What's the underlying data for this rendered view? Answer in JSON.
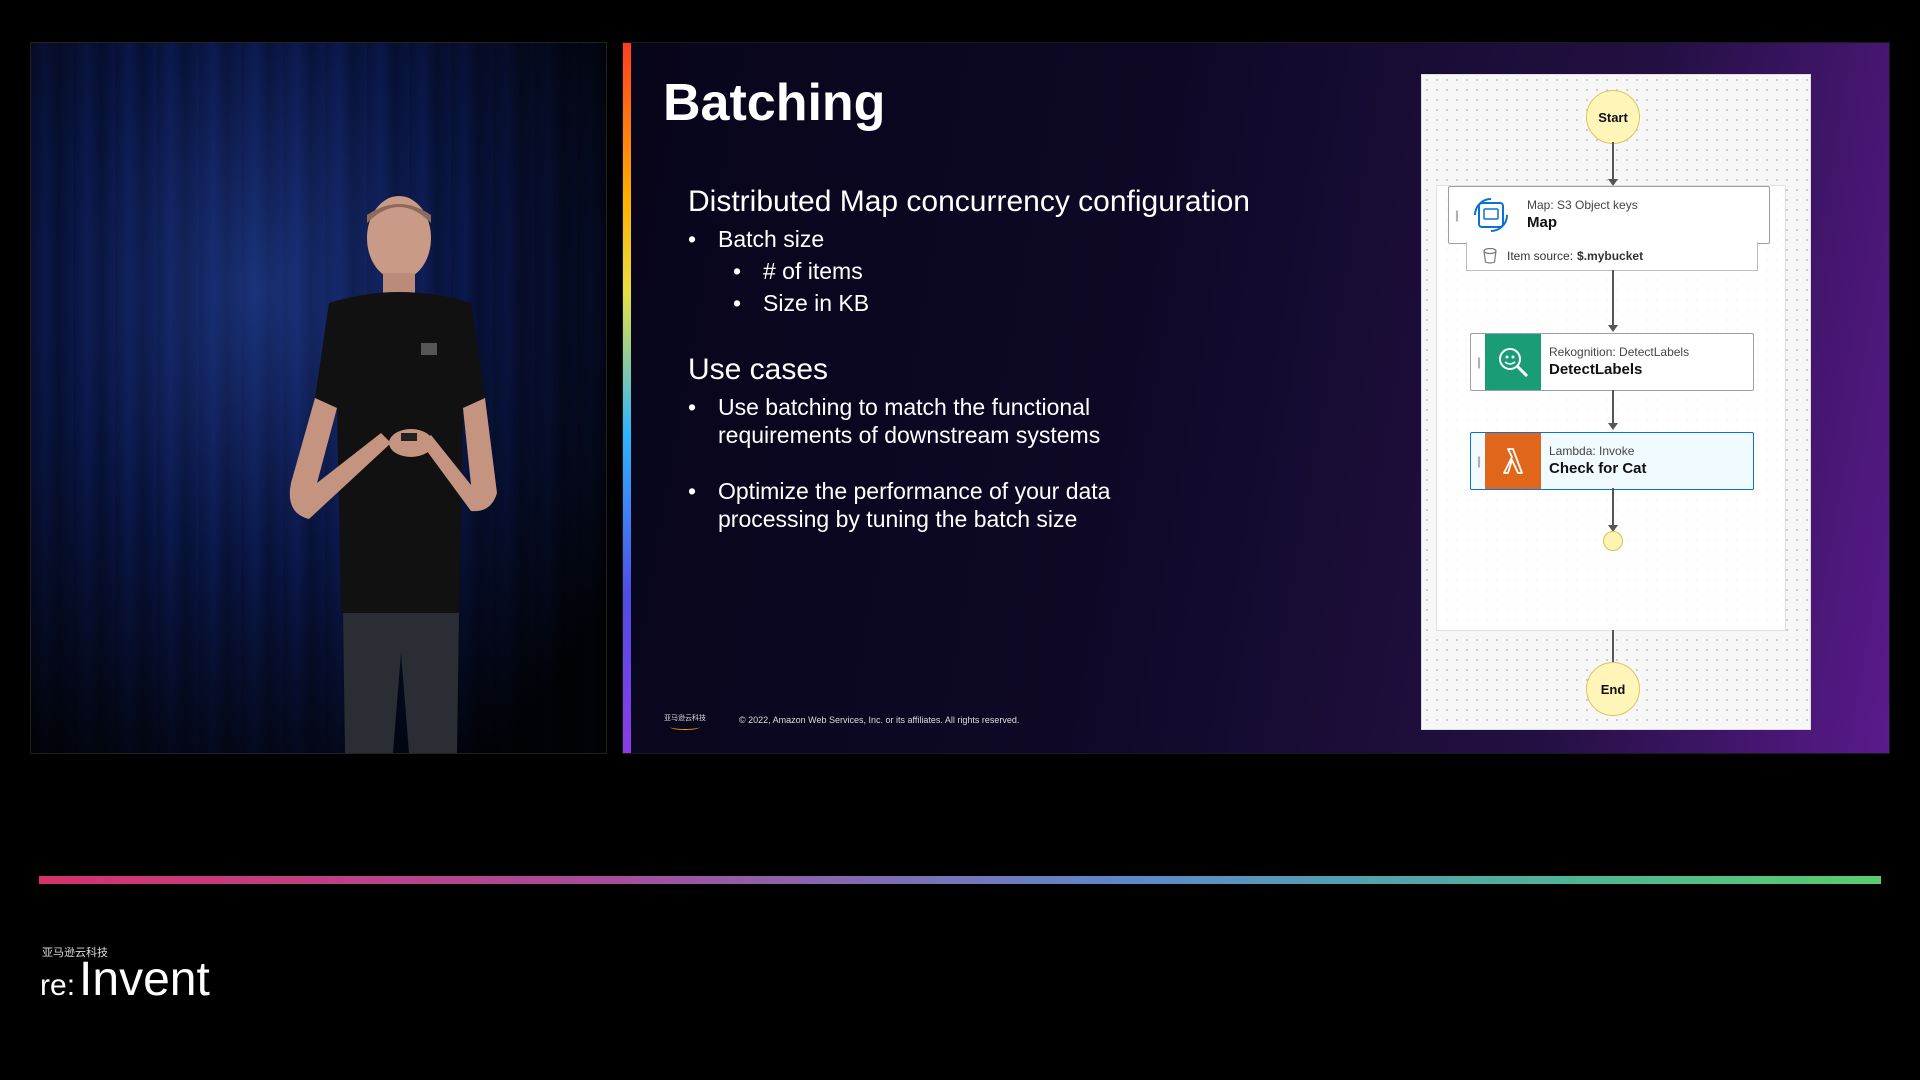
{
  "slide": {
    "title": "Batching",
    "section1": {
      "heading": "Distributed Map concurrency configuration",
      "bullet": "Batch size",
      "sub_bullets": [
        "# of items",
        "Size in KB"
      ]
    },
    "section2": {
      "heading": "Use cases",
      "bullets": [
        "Use batching to match the functional requirements of downstream systems",
        "Optimize the performance of your data processing by tuning the batch size"
      ]
    },
    "footer": {
      "logo_text": "亚马逊云科技",
      "copyright": "© 2022, Amazon Web Services, Inc. or its affiliates. All rights reserved."
    }
  },
  "workflow": {
    "start_label": "Start",
    "end_label": "End",
    "map_state": {
      "type": "Map: S3 Object keys",
      "name": "Map"
    },
    "item_source": {
      "label": "Item source:",
      "value": "$.mybucket"
    },
    "rekognition_state": {
      "type": "Rekognition: DetectLabels",
      "name": "DetectLabels"
    },
    "lambda_state": {
      "type": "Lambda: Invoke",
      "name": "Check for Cat"
    },
    "colors": {
      "terminal_fill": "#fff5b8",
      "map_icon": "#0972d3",
      "rekognition_icon": "#1a9c77",
      "lambda_icon": "#e0661c",
      "selected_border": "#0972d3"
    }
  },
  "brand": {
    "cn": "亚马逊云科技",
    "re": "re",
    "colon": ":",
    "invent": "Invent"
  },
  "icons": {
    "map": "map-state-icon",
    "rekognition": "rekognition-magnifier-icon",
    "lambda": "lambda-icon",
    "bucket": "s3-bucket-icon",
    "drag": "drag-handle-icon"
  }
}
